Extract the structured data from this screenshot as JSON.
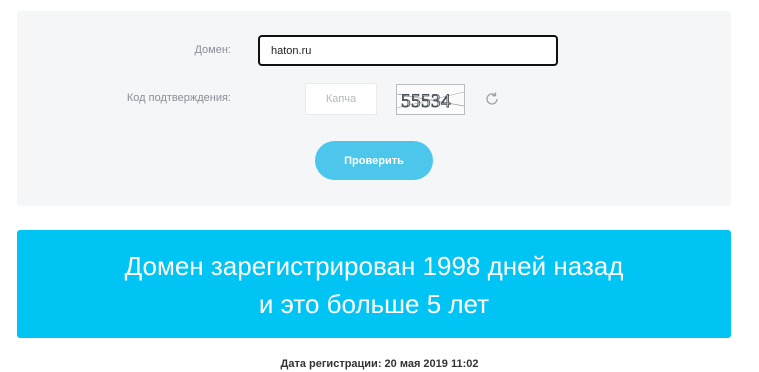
{
  "form": {
    "domain_label": "Домен:",
    "domain_value": "haton.ru",
    "code_label": "Код подтверждения:",
    "captcha_placeholder": "Капча",
    "captcha_text": "55534",
    "refresh_icon": "refresh-icon",
    "check_button": "Проверить"
  },
  "result": {
    "line1": "Домен зарегистрирован 1998 дней назад",
    "line2": "и это больше 5 лет",
    "registration_date": "Дата регистрации: 20 мая 2019 11:02"
  },
  "colors": {
    "panel_bg": "#f4f6f8",
    "button_bg": "#4cc6ea",
    "banner_bg": "#00c4f4"
  }
}
